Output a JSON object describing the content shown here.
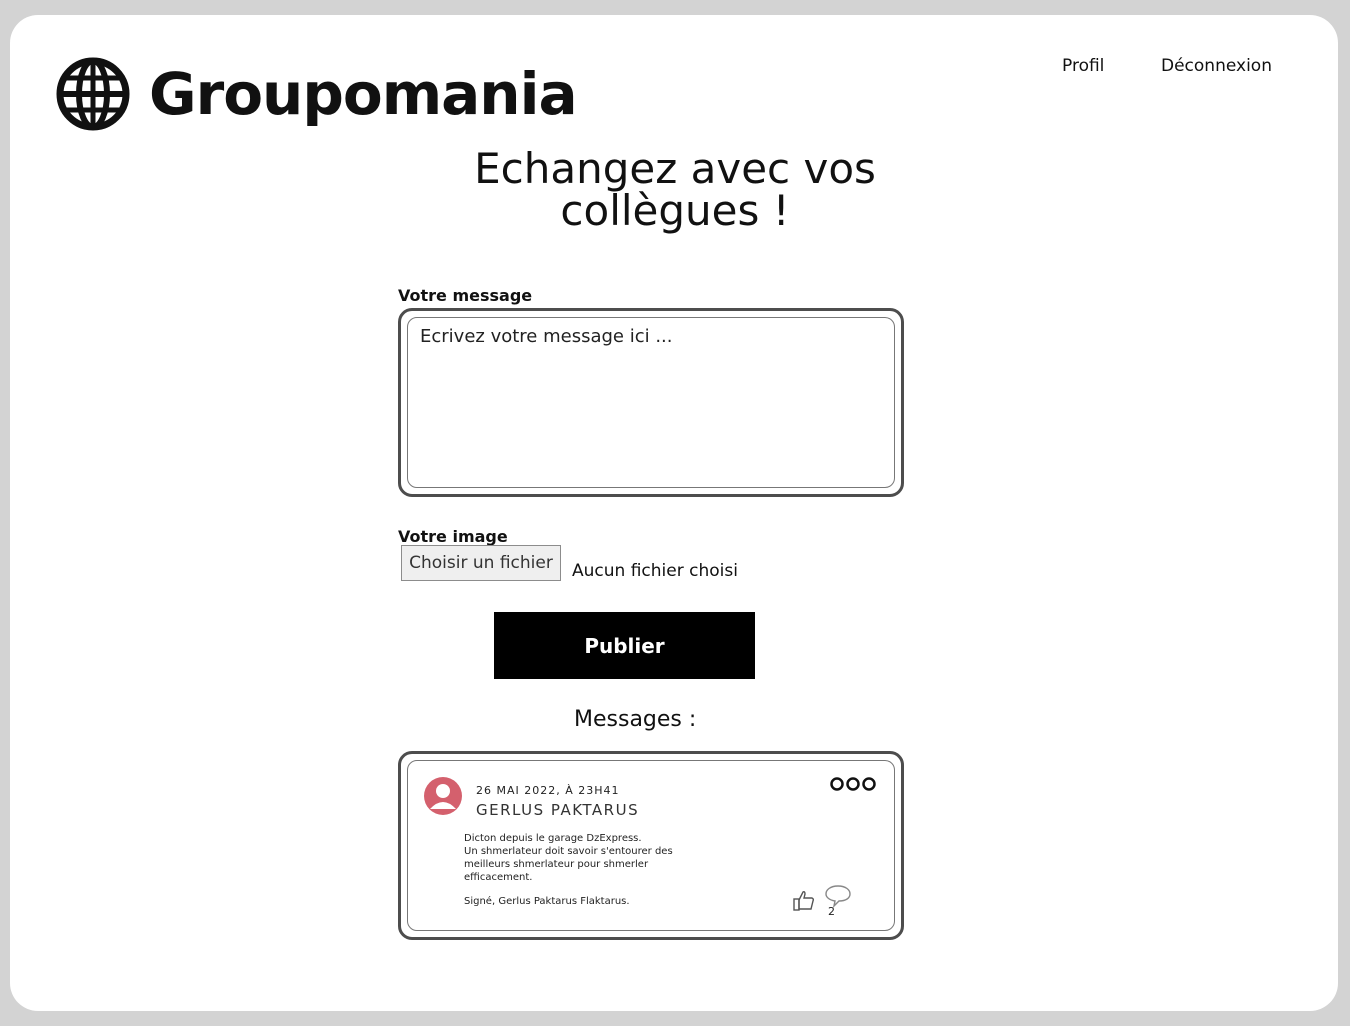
{
  "app": {
    "name": "Groupomania"
  },
  "nav": {
    "profile": "Profil",
    "logout": "Déconnexion"
  },
  "hero": {
    "line1": "Echangez avec vos",
    "line2": "collègues !"
  },
  "form": {
    "message_label": "Votre message",
    "message_placeholder": "Ecrivez votre message ici ...",
    "image_label": "Votre image",
    "file_button": "Choisir un fichier",
    "file_status": "Aucun fichier choisi",
    "publish": "Publier"
  },
  "feed": {
    "title": "Messages :",
    "posts": [
      {
        "date": "26 MAI 2022, À 23H41",
        "author": "GERLUS PAKTARUS",
        "body": [
          "Dicton depuis le garage DzExpress.",
          "Un shmerlateur doit savoir s'entourer des meilleurs shmerlateur pour shmerler efficacement."
        ],
        "signature": "Signé, Gerlus Paktarus Flaktarus.",
        "comments": "2",
        "avatar_color": "#d4606d"
      }
    ]
  },
  "icons": {
    "logo": "globe-icon",
    "avatar": "user-avatar-icon",
    "menu": "more-options-icon",
    "like": "thumbs-up-icon",
    "comment": "comment-bubble-icon"
  }
}
